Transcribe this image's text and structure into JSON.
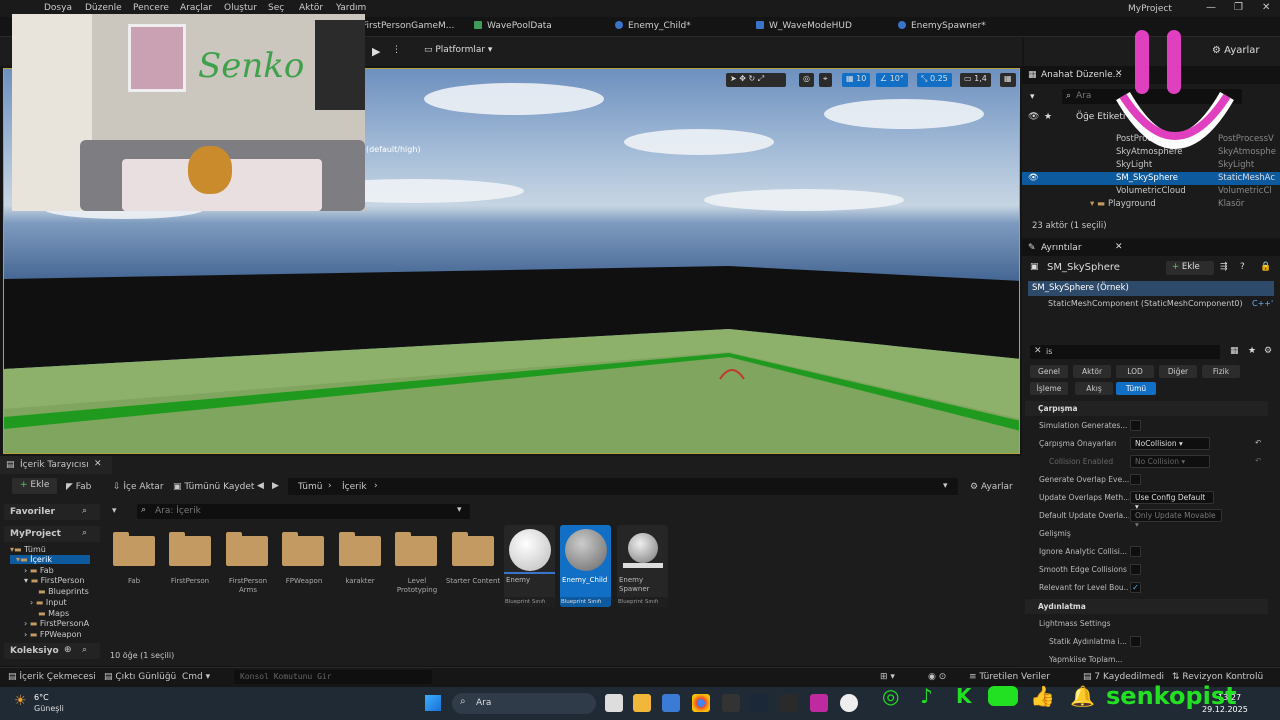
{
  "menu": [
    "Dosya",
    "Düzenle",
    "Pencere",
    "Araçlar",
    "Oluştur",
    "Seç",
    "Aktör",
    "Yardım"
  ],
  "project_name": "MyProject",
  "tabs": [
    "FirstPersonGameM...",
    "WavePoolData",
    "Enemy_Child*",
    "W_WaveModeHUD",
    "EnemySpawner*"
  ],
  "toolbar": {
    "platforms": "Platformlar",
    "settings": "Ayarlar"
  },
  "viewport": {
    "scalability": "(default/high)",
    "grid": "10",
    "rot": "10°",
    "scale": "0.25",
    "cam": "1,4"
  },
  "outliner": {
    "title": "Anahat Düzenle...",
    "search_placeholder": "Ara",
    "column": "Öğe Etiketi",
    "rows": [
      {
        "name": "PostProcessVolume",
        "type": "PostProcessV"
      },
      {
        "name": "SkyAtmosphere",
        "type": "SkyAtmosphe"
      },
      {
        "name": "SkyLight",
        "type": "SkyLight"
      },
      {
        "name": "SM_SkySphere",
        "type": "StaticMeshAc"
      },
      {
        "name": "VolumetricCloud",
        "type": "VolumetricCl"
      },
      {
        "name": "Playground",
        "type": "Klasör"
      }
    ],
    "count": "23 aktör (1 seçili)"
  },
  "details": {
    "title": "Ayrıntılar",
    "object": "SM_SkySphere",
    "add": "Ekle",
    "instance": "SM_SkySphere (Örnek)",
    "component": "StaticMeshComponent (StaticMeshComponent0)",
    "component_tag": "C++'",
    "search": "is",
    "filters": [
      "Genel",
      "Aktör",
      "LOD",
      "Diğer",
      "Fizik",
      "İşleme",
      "Akış",
      "Tümü"
    ],
    "sections": {
      "collision": "Çarpışma",
      "advanced": "Gelişmiş",
      "lighting": "Aydınlatma"
    },
    "props": {
      "sim": "Simulation Generates...",
      "preset": "Çarpışma Önayarları",
      "preset_val": "NoCollision",
      "enabled": "Collision Enabled",
      "enabled_val": "No Collision",
      "overlap": "Generate Overlap Eve...",
      "update": "Update Overlaps Meth...",
      "update_val": "Use Config Default",
      "default_update": "Default Update Overla...",
      "default_update_val": "Only Update Movable",
      "analytic": "Ignore Analytic Collisi...",
      "smooth": "Smooth Edge Collisions",
      "relevant": "Relevant for Level Bou...",
      "lightmass": "Lightmass Settings",
      "static_light": "Statik Aydınlatma i...",
      "more": "Yapmkiise Toplam..."
    }
  },
  "content_browser": {
    "title": "İçerik Tarayıcısı",
    "add": "Ekle",
    "fab": "Fab",
    "import": "İçe Aktar",
    "save_all": "Tümünü Kaydet",
    "path": [
      "Tümü",
      "İçerik"
    ],
    "settings": "Ayarlar",
    "favorites": "Favoriler",
    "project": "MyProject",
    "search_placeholder": "Ara: İçerik",
    "tree": [
      "Tümü",
      "İçerik",
      "Fab",
      "FirstPerson",
      "Blueprints",
      "Input",
      "Maps",
      "FirstPersonA",
      "FPWeapon"
    ],
    "collections": "Koleksiyo",
    "folders": [
      "Fab",
      "FirstPerson",
      "FirstPerson Arms",
      "FPWeapon",
      "karakter",
      "Level Prototyping",
      "Starter Content"
    ],
    "assets": [
      {
        "name": "Enemy",
        "type": "Blueprint Sınıfı"
      },
      {
        "name": "Enemy_Child",
        "type": "Blueprint Sınıfı"
      },
      {
        "name": "Enemy Spawner",
        "type": "Blueprint Sınıfı"
      }
    ],
    "count": "10 öğe (1 seçili)"
  },
  "statusbar": {
    "drawer": "İçerik Çekmecesi",
    "log": "Çıktı Günlüğü",
    "cmd": "Cmd",
    "console_placeholder": "Konsol Komutunu Gir",
    "derived": "Türetilen Veriler",
    "saved": "7 Kaydedilmedi",
    "revision": "Revizyon Kontrolü"
  },
  "taskbar": {
    "temp": "6°C",
    "weather": "Güneşli",
    "search": "Ara",
    "time": "13:27",
    "date": "29.12.2025"
  },
  "overlay": {
    "brand": "senkopist"
  },
  "colors": {
    "accent": "#1170c6",
    "selection": "#0e5a9e",
    "floor_edge": "#1f9a1f"
  }
}
